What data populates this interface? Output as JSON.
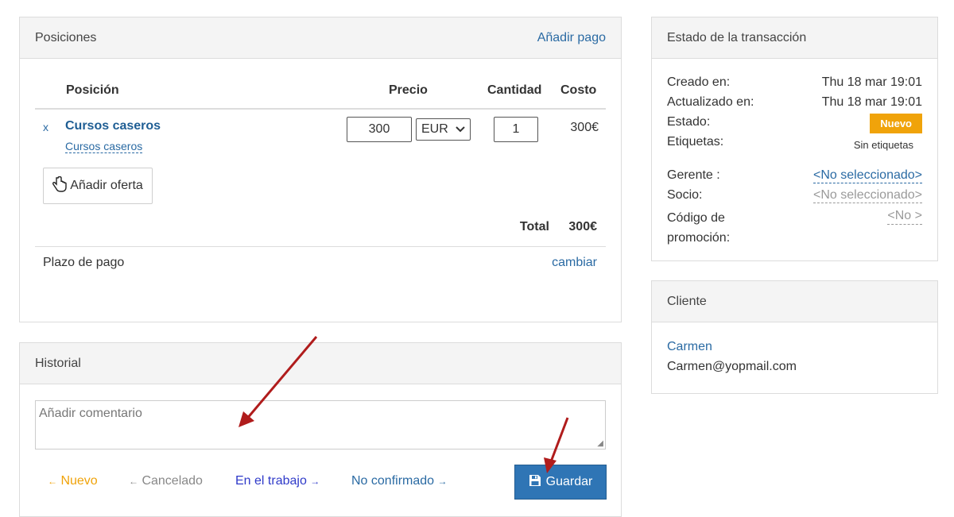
{
  "positions": {
    "header_title": "Posiciones",
    "add_payment": "Añadir pago",
    "columns": {
      "position": "Posición",
      "price": "Precio",
      "quantity": "Cantidad",
      "cost": "Costo"
    },
    "item": {
      "remove": "x",
      "title": "Cursos caseros",
      "subtitle": "Cursos caseros",
      "price": "300",
      "currency": "EUR",
      "quantity": "1",
      "cost": "300€"
    },
    "add_offer": "Añadir oferta",
    "total_label": "Total",
    "total_value": "300€",
    "payment_term_label": "Plazo de pago",
    "payment_term_change": "cambiar"
  },
  "history": {
    "header_title": "Historial",
    "comment_placeholder": "Añadir comentario",
    "statuses": [
      {
        "label": "Nuevo",
        "arrow": "←",
        "color": "#f0a30a"
      },
      {
        "label": "Cancelado",
        "arrow": "←",
        "color": "#888888"
      },
      {
        "label": "En el trabajo",
        "arrow": "→",
        "color": "#2f3ac9"
      },
      {
        "label": "No confirmado",
        "arrow": "→",
        "color": "#2a6aa3"
      }
    ],
    "save_label": "Guardar"
  },
  "transaction": {
    "header_title": "Estado de la transacción",
    "created_label": "Creado en:",
    "created_value": "Thu 18 mar 19:01",
    "updated_label": "Actualizado en:",
    "updated_value": "Thu 18 mar 19:01",
    "status_label": "Estado:",
    "status_value": "Nuevo",
    "tags_label": "Etiquetas:",
    "tags_value": "Sin etiquetas",
    "manager_label": "Gerente :",
    "manager_value": "<No seleccionado>",
    "partner_label": "Socio:",
    "partner_value": "<No seleccionado>",
    "promo_label_1": "Código de",
    "promo_label_2": "promoción:",
    "promo_value": "<No >"
  },
  "client": {
    "header_title": "Cliente",
    "name": "Carmen",
    "email": "Carmen@yopmail.com"
  },
  "colors": {
    "accent": "#2a6aa3",
    "save_button": "#2f75b5",
    "status_badge": "#f0a30a",
    "annotation_arrow": "#b01c1c"
  }
}
